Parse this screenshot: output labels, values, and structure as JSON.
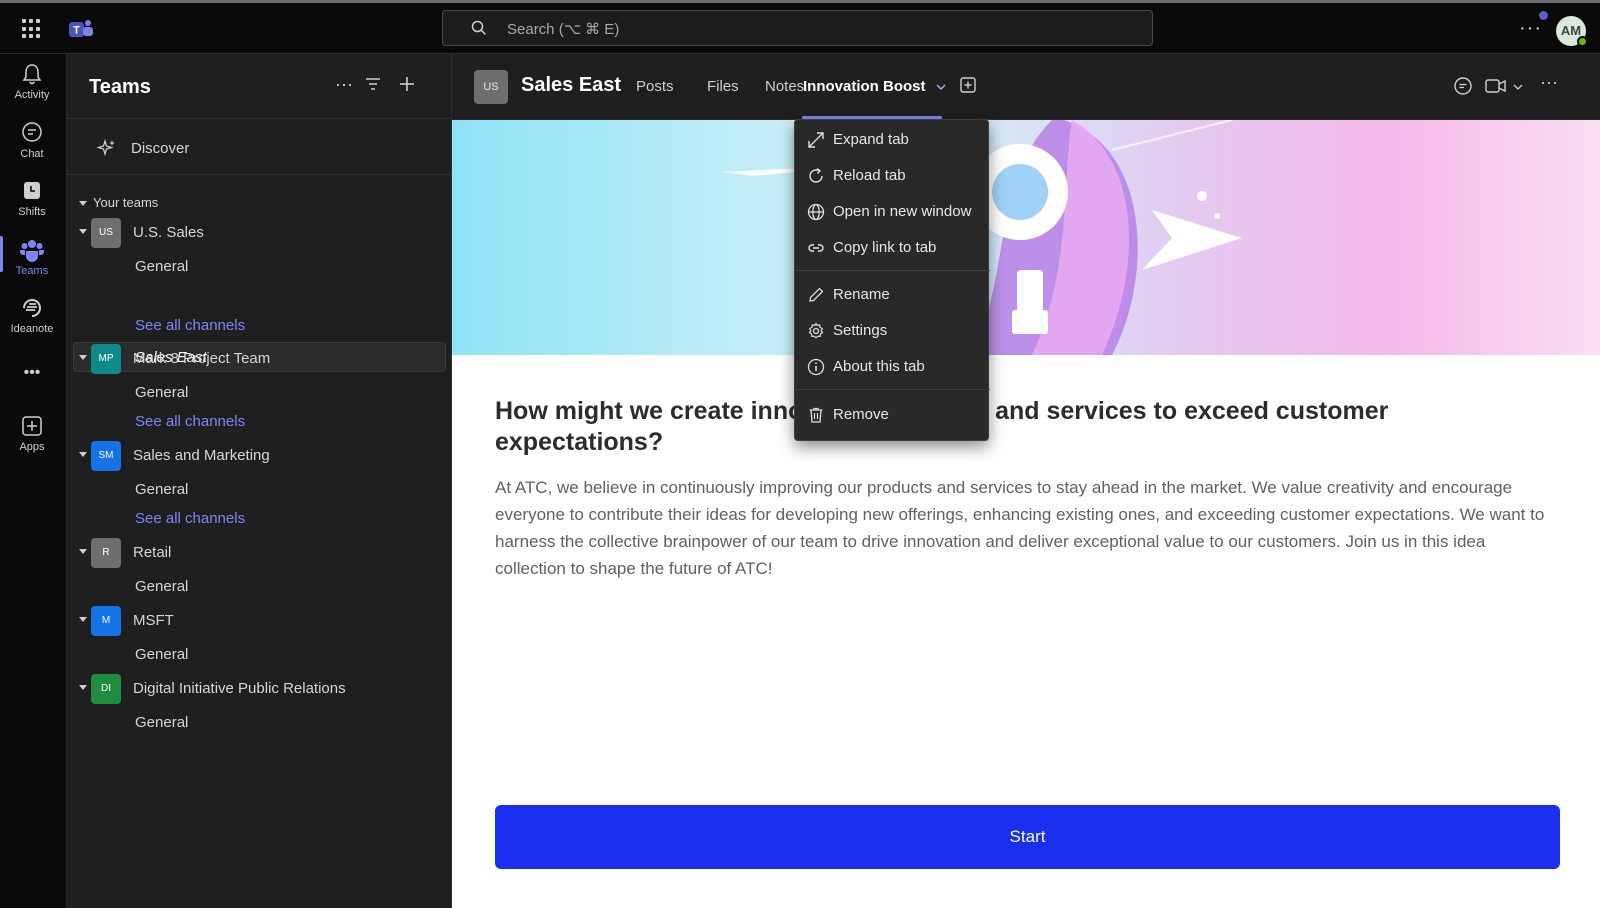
{
  "search": {
    "placeholder": "Search (⌥ ⌘ E)"
  },
  "user": {
    "initials": "AM"
  },
  "rail": {
    "items": [
      {
        "label": "Activity",
        "icon": "bell-icon"
      },
      {
        "label": "Chat",
        "icon": "chat-icon"
      },
      {
        "label": "Shifts",
        "icon": "shifts-icon"
      },
      {
        "label": "Teams",
        "icon": "teams-icon"
      },
      {
        "label": "Ideanote",
        "icon": "ideanote-icon"
      },
      {
        "label": "Apps",
        "icon": "plus-square-icon"
      }
    ],
    "more": "•••"
  },
  "sidebar": {
    "title": "Teams",
    "discover": "Discover",
    "your_teams": "Your teams",
    "teams": [
      {
        "initials": "US",
        "name": "U.S. Sales",
        "color": "#6e6e6e",
        "channels": [
          "General",
          "Sales East"
        ],
        "see_all": "See all channels"
      },
      {
        "initials": "MP",
        "name": "Mark 8 Project Team",
        "color": "#0e8a8a",
        "channels": [
          "General"
        ],
        "see_all": "See all channels"
      },
      {
        "initials": "SM",
        "name": "Sales and Marketing",
        "color": "#1473e6",
        "channels": [
          "General"
        ],
        "see_all": "See all channels"
      },
      {
        "initials": "R",
        "name": "Retail",
        "color": "#6e6e6e",
        "channels": [
          "General"
        ]
      },
      {
        "initials": "M",
        "name": "MSFT",
        "color": "#1473e6",
        "channels": [
          "General"
        ]
      },
      {
        "initials": "DI",
        "name": "Digital Initiative Public Relations",
        "color": "#1e8e3e",
        "channels": [
          "General"
        ]
      }
    ]
  },
  "channel_header": {
    "avatar": "US",
    "title": "Sales East",
    "tabs": [
      "Posts",
      "Files",
      "Notes",
      "Innovation Boost"
    ],
    "active_tab": "Innovation Boost"
  },
  "tab_menu": {
    "items": [
      "Expand tab",
      "Reload tab",
      "Open in new window",
      "Copy link to tab",
      "Rename",
      "Settings",
      "About this tab",
      "Remove"
    ]
  },
  "content": {
    "heading": "How might we create innovative products and services to exceed customer expectations?",
    "body": "At ATC, we believe in continuously improving our products and services to stay ahead in the market. We value creativity and encourage everyone to contribute their ideas for developing new offerings, enhancing existing ones, and exceeding customer expectations. We want to harness the collective brainpower of our team to drive innovation and deliver exceptional value to our customers. Join us in this idea collection to shape the future of ATC!",
    "start_label": "Start"
  },
  "colors": {
    "accent": "#7f85f5",
    "start_button": "#1a2ff0"
  }
}
